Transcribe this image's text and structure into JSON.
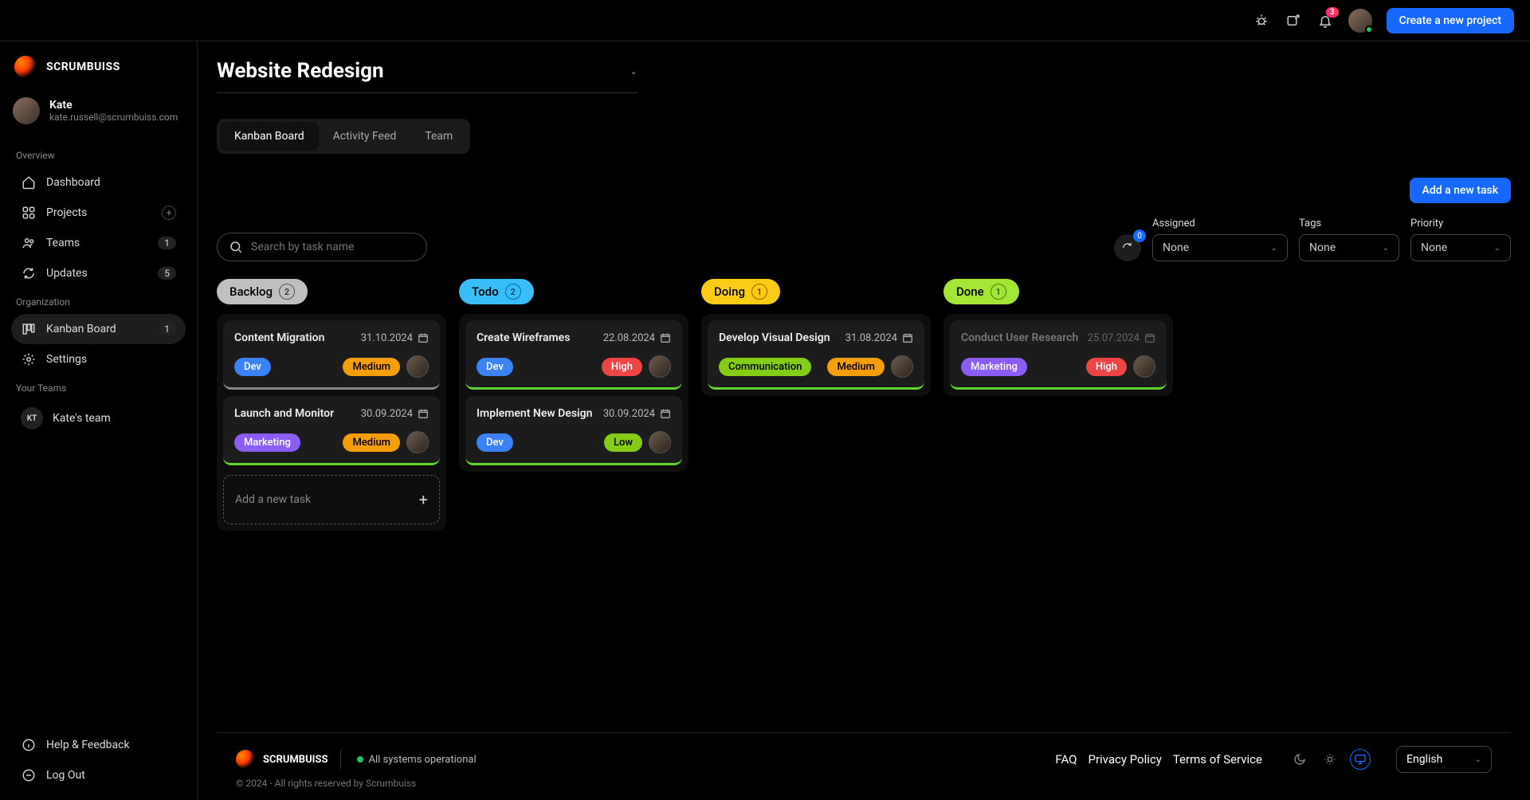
{
  "header": {
    "notif_count": "3",
    "create_project": "Create a new project"
  },
  "brand": {
    "name": "SCRUMBUISS"
  },
  "user": {
    "name": "Kate",
    "email": "kate.russell@scrumbuiss.com"
  },
  "sections": {
    "overview": "Overview",
    "organization": "Organization",
    "your_teams": "Your Teams"
  },
  "nav": {
    "dashboard": "Dashboard",
    "projects": "Projects",
    "teams": "Teams",
    "teams_count": "1",
    "updates": "Updates",
    "updates_count": "5",
    "kanban": "Kanban Board",
    "kanban_count": "1",
    "settings": "Settings",
    "team1_short": "KT",
    "team1": "Kate's team",
    "help": "Help & Feedback",
    "logout": "Log Out"
  },
  "project": {
    "title": "Website Redesign"
  },
  "tabs": {
    "kanban": "Kanban Board",
    "activity": "Activity Feed",
    "team": "Team"
  },
  "buttons": {
    "add_task": "Add a new task",
    "add_task_card": "Add a new task"
  },
  "search": {
    "placeholder": "Search by task name"
  },
  "refresh_count": "0",
  "filters": {
    "assigned_label": "Assigned",
    "assigned_value": "None",
    "tags_label": "Tags",
    "tags_value": "None",
    "priority_label": "Priority",
    "priority_value": "None"
  },
  "columns": {
    "backlog": {
      "label": "Backlog",
      "count": "2"
    },
    "todo": {
      "label": "Todo",
      "count": "2"
    },
    "doing": {
      "label": "Doing",
      "count": "1"
    },
    "done": {
      "label": "Done",
      "count": "1"
    }
  },
  "cards": {
    "c1": {
      "title": "Content Migration",
      "date": "31.10.2024",
      "tag": "Dev",
      "priority": "Medium"
    },
    "c2": {
      "title": "Launch and Monitor",
      "date": "30.09.2024",
      "tag": "Marketing",
      "priority": "Medium"
    },
    "c3": {
      "title": "Create Wireframes",
      "date": "22.08.2024",
      "tag": "Dev",
      "priority": "High"
    },
    "c4": {
      "title": "Implement New Design",
      "date": "30.09.2024",
      "tag": "Dev",
      "priority": "Low"
    },
    "c5": {
      "title": "Develop Visual Design",
      "date": "31.08.2024",
      "tag": "Communication",
      "priority": "Medium"
    },
    "c6": {
      "title": "Conduct User Research",
      "date": "25.07.2024",
      "tag": "Marketing",
      "priority": "High"
    }
  },
  "footer": {
    "brand": "SCRUMBUISS",
    "status": "All systems operational",
    "faq": "FAQ",
    "privacy": "Privacy Policy",
    "terms": "Terms of Service",
    "language": "English",
    "copyright": "© 2024 - All rights reserved by Scrumbuiss"
  }
}
